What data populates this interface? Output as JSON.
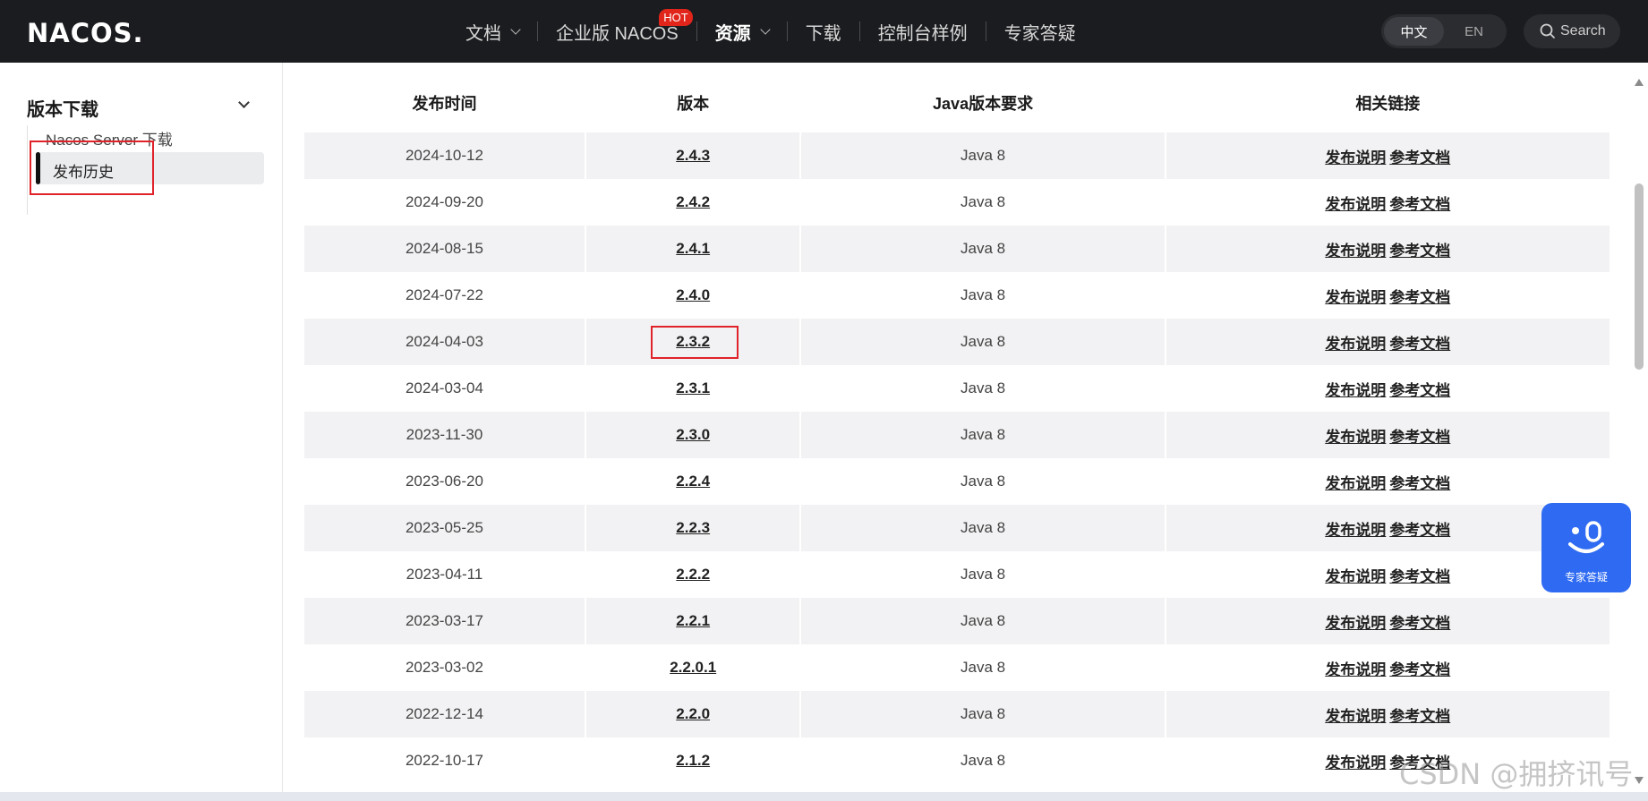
{
  "header": {
    "logo": "NACOS.",
    "nav": [
      {
        "label": "文档",
        "dropdown": true,
        "active": false
      },
      {
        "label": "企业版 NACOS",
        "badge": "HOT",
        "active": false
      },
      {
        "label": "资源",
        "dropdown": true,
        "active": true
      },
      {
        "label": "下载",
        "active": false
      },
      {
        "label": "控制台样例",
        "active": false
      },
      {
        "label": "专家答疑",
        "active": false
      }
    ],
    "lang": {
      "zh": "中文",
      "en": "EN"
    },
    "search_label": "Search"
  },
  "sidebar": {
    "title": "版本下载",
    "sub_item": "Nacos Server 下载",
    "active_item": "发布历史"
  },
  "table": {
    "headers": [
      "发布时间",
      "版本",
      "Java版本要求",
      "相关链接"
    ],
    "link_labels": [
      "发布说明",
      "参考文档"
    ],
    "rows": [
      {
        "date": "2024-10-12",
        "version": "2.4.3",
        "java": "Java 8"
      },
      {
        "date": "2024-09-20",
        "version": "2.4.2",
        "java": "Java 8"
      },
      {
        "date": "2024-08-15",
        "version": "2.4.1",
        "java": "Java 8"
      },
      {
        "date": "2024-07-22",
        "version": "2.4.0",
        "java": "Java 8"
      },
      {
        "date": "2024-04-03",
        "version": "2.3.2",
        "java": "Java 8"
      },
      {
        "date": "2024-03-04",
        "version": "2.3.1",
        "java": "Java 8"
      },
      {
        "date": "2023-11-30",
        "version": "2.3.0",
        "java": "Java 8"
      },
      {
        "date": "2023-06-20",
        "version": "2.2.4",
        "java": "Java 8"
      },
      {
        "date": "2023-05-25",
        "version": "2.2.3",
        "java": "Java 8"
      },
      {
        "date": "2023-04-11",
        "version": "2.2.2",
        "java": "Java 8"
      },
      {
        "date": "2023-03-17",
        "version": "2.2.1",
        "java": "Java 8"
      },
      {
        "date": "2023-03-02",
        "version": "2.2.0.1",
        "java": "Java 8"
      },
      {
        "date": "2022-12-14",
        "version": "2.2.0",
        "java": "Java 8"
      },
      {
        "date": "2022-10-17",
        "version": "2.1.2",
        "java": "Java 8"
      }
    ]
  },
  "float_widget": {
    "label": "专家答疑",
    "icon": "assistant-face-icon"
  },
  "watermark": "CSDN @拥挤讯号",
  "colors": {
    "topbar": "#1b1c1f",
    "accent_red": "#e0232a",
    "widget_blue": "#2f6bf2",
    "row_alt": "#f2f2f4"
  }
}
